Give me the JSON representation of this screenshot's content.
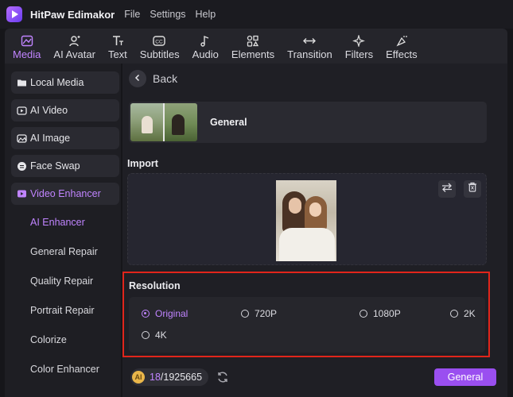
{
  "app": {
    "title": "HitPaw Edimakor"
  },
  "menu": [
    "File",
    "Settings",
    "Help"
  ],
  "toolbar": {
    "tabs": [
      {
        "label": "Media",
        "icon": "media-icon",
        "active": true
      },
      {
        "label": "AI Avatar",
        "icon": "avatar-icon"
      },
      {
        "label": "Text",
        "icon": "text-icon"
      },
      {
        "label": "Subtitles",
        "icon": "subtitles-icon"
      },
      {
        "label": "Audio",
        "icon": "audio-icon"
      },
      {
        "label": "Elements",
        "icon": "elements-icon"
      },
      {
        "label": "Transition",
        "icon": "transition-icon"
      },
      {
        "label": "Filters",
        "icon": "filters-icon"
      },
      {
        "label": "Effects",
        "icon": "effects-icon"
      }
    ]
  },
  "sidebar": {
    "items": [
      {
        "label": "Local Media",
        "icon": "folder-icon"
      },
      {
        "label": "AI Video",
        "icon": "ai-video-icon"
      },
      {
        "label": "AI Image",
        "icon": "ai-image-icon"
      },
      {
        "label": "Face Swap",
        "icon": "face-swap-icon"
      },
      {
        "label": "Video Enhancer",
        "icon": "video-enhancer-icon",
        "active": true
      }
    ],
    "subitems": [
      {
        "label": "AI Enhancer",
        "active": true
      },
      {
        "label": "General Repair"
      },
      {
        "label": "Quality Repair"
      },
      {
        "label": "Portrait Repair"
      },
      {
        "label": "Colorize"
      },
      {
        "label": "Color Enhancer"
      }
    ]
  },
  "main": {
    "back_label": "Back",
    "model_card": {
      "label": "General"
    },
    "import_label": "Import",
    "resolution": {
      "label": "Resolution",
      "options": [
        {
          "label": "Original",
          "selected": true
        },
        {
          "label": "720P"
        },
        {
          "label": "1080P"
        },
        {
          "label": "2K"
        },
        {
          "label": "4K"
        }
      ]
    },
    "credits": {
      "used": "18",
      "total": "/1925665"
    },
    "action_button": "General"
  },
  "colors": {
    "accent": "#c084ff",
    "button": "#9a4ff0",
    "highlight_border": "#e1251b"
  }
}
